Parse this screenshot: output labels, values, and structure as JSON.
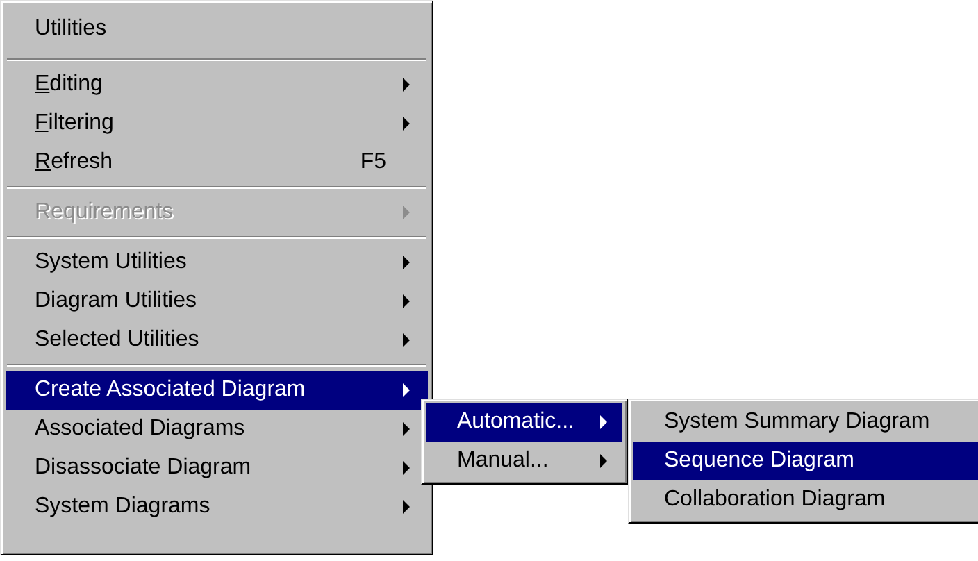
{
  "main_menu": {
    "title": "Utilities",
    "sections": [
      {
        "items": [
          {
            "label": "Editing",
            "submenu": true,
            "disabled": false,
            "selected": false,
            "underline_first": true
          },
          {
            "label": "Filtering",
            "submenu": true,
            "disabled": false,
            "selected": false,
            "underline_first": true
          },
          {
            "label": "Refresh",
            "shortcut": "F5",
            "submenu": false,
            "disabled": false,
            "selected": false,
            "underline_first": true
          }
        ]
      },
      {
        "items": [
          {
            "label": "Requirements",
            "submenu": true,
            "disabled": true,
            "selected": false,
            "underline_first": false
          }
        ]
      },
      {
        "items": [
          {
            "label": "System Utilities",
            "submenu": true,
            "disabled": false,
            "selected": false,
            "underline_first": false
          },
          {
            "label": "Diagram Utilities",
            "submenu": true,
            "disabled": false,
            "selected": false,
            "underline_first": false
          },
          {
            "label": "Selected Utilities",
            "submenu": true,
            "disabled": false,
            "selected": false,
            "underline_first": false
          }
        ]
      },
      {
        "items": [
          {
            "label": "Create Associated Diagram",
            "submenu": true,
            "disabled": false,
            "selected": true,
            "underline_first": false
          },
          {
            "label": "Associated Diagrams",
            "submenu": true,
            "disabled": false,
            "selected": false,
            "underline_first": false
          },
          {
            "label": "Disassociate Diagram",
            "submenu": true,
            "disabled": false,
            "selected": false,
            "underline_first": false
          },
          {
            "label": "System Diagrams",
            "submenu": true,
            "disabled": false,
            "selected": false,
            "underline_first": false
          }
        ]
      }
    ]
  },
  "submenu": {
    "items": [
      {
        "label": "Automatic...",
        "submenu": true,
        "disabled": false,
        "selected": true,
        "underline_first": false
      },
      {
        "label": "Manual...",
        "submenu": true,
        "disabled": false,
        "selected": false,
        "underline_first": false
      }
    ]
  },
  "sub_submenu": {
    "items": [
      {
        "label": "System Summary Diagram",
        "submenu": false,
        "disabled": false,
        "selected": false,
        "underline_first": false
      },
      {
        "label": "Sequence Diagram",
        "submenu": false,
        "disabled": false,
        "selected": true,
        "underline_first": false
      },
      {
        "label": "Collaboration Diagram",
        "submenu": false,
        "disabled": false,
        "selected": false,
        "underline_first": false
      }
    ]
  }
}
